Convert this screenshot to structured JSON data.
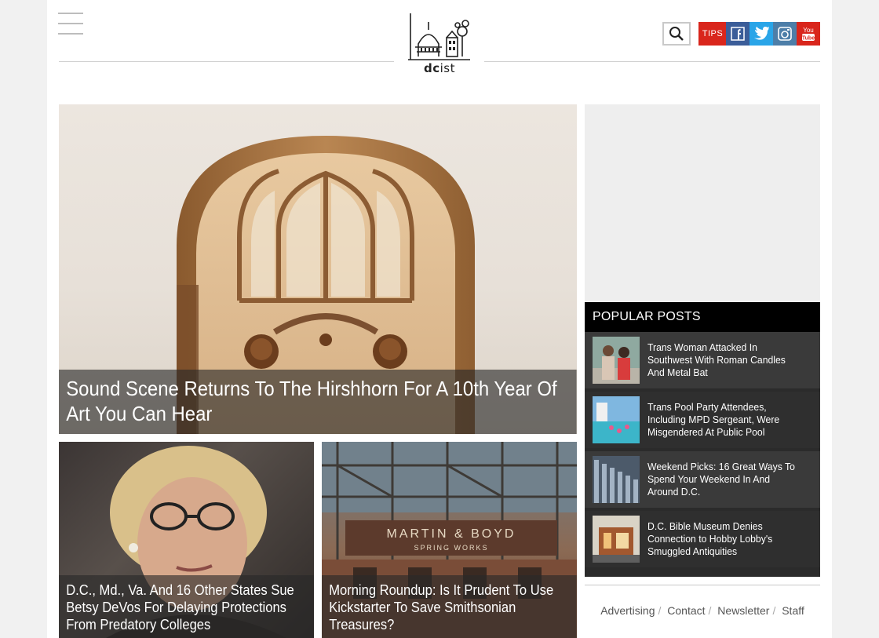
{
  "header": {
    "logo_text_bold": "dc",
    "logo_text_rest": "ist",
    "tips_label": "TIPS"
  },
  "colors": {
    "tips": "#d9261c",
    "facebook": "#3b5d99",
    "twitter": "#2aa5e8",
    "instagram": "#4d7ea8",
    "youtube": "#d9261c"
  },
  "hero": {
    "title": "Sound Scene Returns To The Hirshhorn For A 10th Year Of Art You Can Hear"
  },
  "cards": [
    {
      "title": "D.C., Md., Va. And 16 Other States Sue Betsy DeVos For Delaying Protections From Predatory Colleges"
    },
    {
      "title": "Morning Roundup: Is It Prudent To Use Kickstarter To Save Smithsonian Treasures?",
      "sign_line1": "MARTIN & BOYD",
      "sign_line2": "SPRING WORKS"
    }
  ],
  "popular": {
    "heading": "POPULAR POSTS",
    "items": [
      {
        "title": "Trans Woman Attacked In Southwest With Roman Candles And Metal Bat"
      },
      {
        "title": "Trans Pool Party Attendees, Including MPD Sergeant, Were Misgendered At Public Pool"
      },
      {
        "title": "Weekend Picks: 16 Great Ways To Spend Your Weekend In And Around D.C."
      },
      {
        "title": "D.C. Bible Museum Denies Connection to Hobby Lobby's Smuggled Antiquities"
      }
    ]
  },
  "footer": {
    "links": [
      "Advertising",
      "Contact",
      "Newsletter",
      "Staff"
    ]
  }
}
